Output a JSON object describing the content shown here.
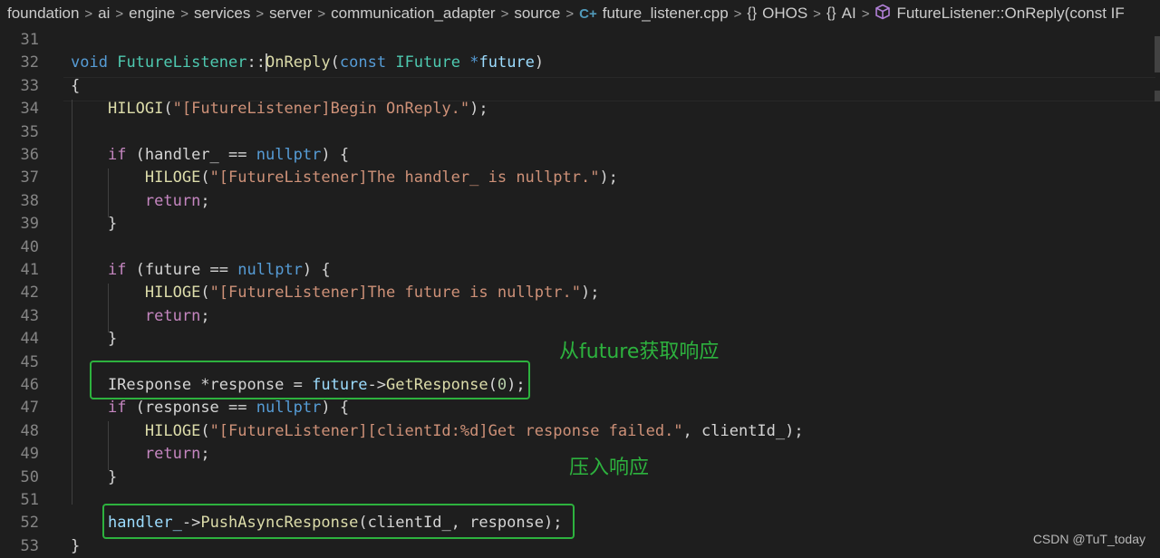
{
  "breadcrumb": {
    "items": [
      "foundation",
      "ai",
      "engine",
      "services",
      "server",
      "communication_adapter",
      "source"
    ],
    "file": "future_listener.cpp",
    "namespaces": [
      "OHOS",
      "AI"
    ],
    "symbol": "FutureListener::OnReply(const IF",
    "separator": ">",
    "icons": {
      "file": "cpp-file-icon",
      "namespace": "braces-icon",
      "method": "cube-icon"
    },
    "ns_glyph": "{}",
    "cpp_glyph": "C+"
  },
  "lines": [
    {
      "n": "31",
      "t": []
    },
    {
      "n": "32",
      "t": [
        [
          "kw",
          "void"
        ],
        [
          "txt",
          " "
        ],
        [
          "ty",
          "FutureListener"
        ],
        [
          "txt",
          "::"
        ],
        [
          "cursor",
          ""
        ],
        [
          "fn",
          "OnReply"
        ],
        [
          "txt",
          "("
        ],
        [
          "kw",
          "const"
        ],
        [
          "txt",
          " "
        ],
        [
          "ty",
          "IFuture"
        ],
        [
          "txt",
          " "
        ],
        [
          "kw",
          "*"
        ],
        [
          "var",
          "future"
        ],
        [
          "txt",
          ")"
        ]
      ]
    },
    {
      "n": "33",
      "t": [
        [
          "txt",
          "{"
        ]
      ]
    },
    {
      "n": "34",
      "t": [
        [
          "txt",
          "    "
        ],
        [
          "fn",
          "HILOGI"
        ],
        [
          "txt",
          "("
        ],
        [
          "str",
          "\"[FutureListener]Begin OnReply.\""
        ],
        [
          "txt",
          ");"
        ]
      ]
    },
    {
      "n": "35",
      "t": []
    },
    {
      "n": "36",
      "t": [
        [
          "txt",
          "    "
        ],
        [
          "ctl",
          "if"
        ],
        [
          "txt",
          " (handler_ == "
        ],
        [
          "kw",
          "nullptr"
        ],
        [
          "txt",
          ") {"
        ]
      ]
    },
    {
      "n": "37",
      "t": [
        [
          "txt",
          "        "
        ],
        [
          "fn",
          "HILOGE"
        ],
        [
          "txt",
          "("
        ],
        [
          "str",
          "\"[FutureListener]The handler_ is nullptr.\""
        ],
        [
          "txt",
          ");"
        ]
      ]
    },
    {
      "n": "38",
      "t": [
        [
          "txt",
          "        "
        ],
        [
          "ctl",
          "return"
        ],
        [
          "txt",
          ";"
        ]
      ]
    },
    {
      "n": "39",
      "t": [
        [
          "txt",
          "    }"
        ]
      ]
    },
    {
      "n": "40",
      "t": []
    },
    {
      "n": "41",
      "t": [
        [
          "txt",
          "    "
        ],
        [
          "ctl",
          "if"
        ],
        [
          "txt",
          " (future == "
        ],
        [
          "kw",
          "nullptr"
        ],
        [
          "txt",
          ") {"
        ]
      ]
    },
    {
      "n": "42",
      "t": [
        [
          "txt",
          "        "
        ],
        [
          "fn",
          "HILOGE"
        ],
        [
          "txt",
          "("
        ],
        [
          "str",
          "\"[FutureListener]The future is nullptr.\""
        ],
        [
          "txt",
          ");"
        ]
      ]
    },
    {
      "n": "43",
      "t": [
        [
          "txt",
          "        "
        ],
        [
          "ctl",
          "return"
        ],
        [
          "txt",
          ";"
        ]
      ]
    },
    {
      "n": "44",
      "t": [
        [
          "txt",
          "    }"
        ]
      ]
    },
    {
      "n": "45",
      "t": []
    },
    {
      "n": "46",
      "t": [
        [
          "txt",
          "    IResponse *response = "
        ],
        [
          "var",
          "future"
        ],
        [
          "txt",
          "->"
        ],
        [
          "fn",
          "GetResponse"
        ],
        [
          "txt",
          "("
        ],
        [
          "num",
          "0"
        ],
        [
          "txt",
          ");"
        ]
      ]
    },
    {
      "n": "47",
      "t": [
        [
          "txt",
          "    "
        ],
        [
          "ctl",
          "if"
        ],
        [
          "txt",
          " (response == "
        ],
        [
          "kw",
          "nullptr"
        ],
        [
          "txt",
          ") {"
        ]
      ]
    },
    {
      "n": "48",
      "t": [
        [
          "txt",
          "        "
        ],
        [
          "fn",
          "HILOGE"
        ],
        [
          "txt",
          "("
        ],
        [
          "str",
          "\"[FutureListener][clientId:%d]Get response failed.\""
        ],
        [
          "txt",
          ", clientId_);"
        ]
      ]
    },
    {
      "n": "49",
      "t": [
        [
          "txt",
          "        "
        ],
        [
          "ctl",
          "return"
        ],
        [
          "txt",
          ";"
        ]
      ]
    },
    {
      "n": "50",
      "t": [
        [
          "txt",
          "    }"
        ]
      ]
    },
    {
      "n": "51",
      "t": []
    },
    {
      "n": "52",
      "t": [
        [
          "txt",
          "    "
        ],
        [
          "var",
          "handler_"
        ],
        [
          "txt",
          "->"
        ],
        [
          "fn",
          "PushAsyncResponse"
        ],
        [
          "txt",
          "(clientId_, response);"
        ]
      ]
    },
    {
      "n": "53",
      "t": [
        [
          "txt",
          "}"
        ]
      ]
    }
  ],
  "annotations": {
    "get_response": "从future获取响应",
    "push_response": "压入响应"
  },
  "watermark": "CSDN @TuT_today",
  "colors": {
    "annotation": "#2db23e",
    "background": "#1e1e1e",
    "keyword": "#569cd6",
    "function": "#dcdcaa",
    "type": "#4ec9b0",
    "string": "#ce9178"
  }
}
